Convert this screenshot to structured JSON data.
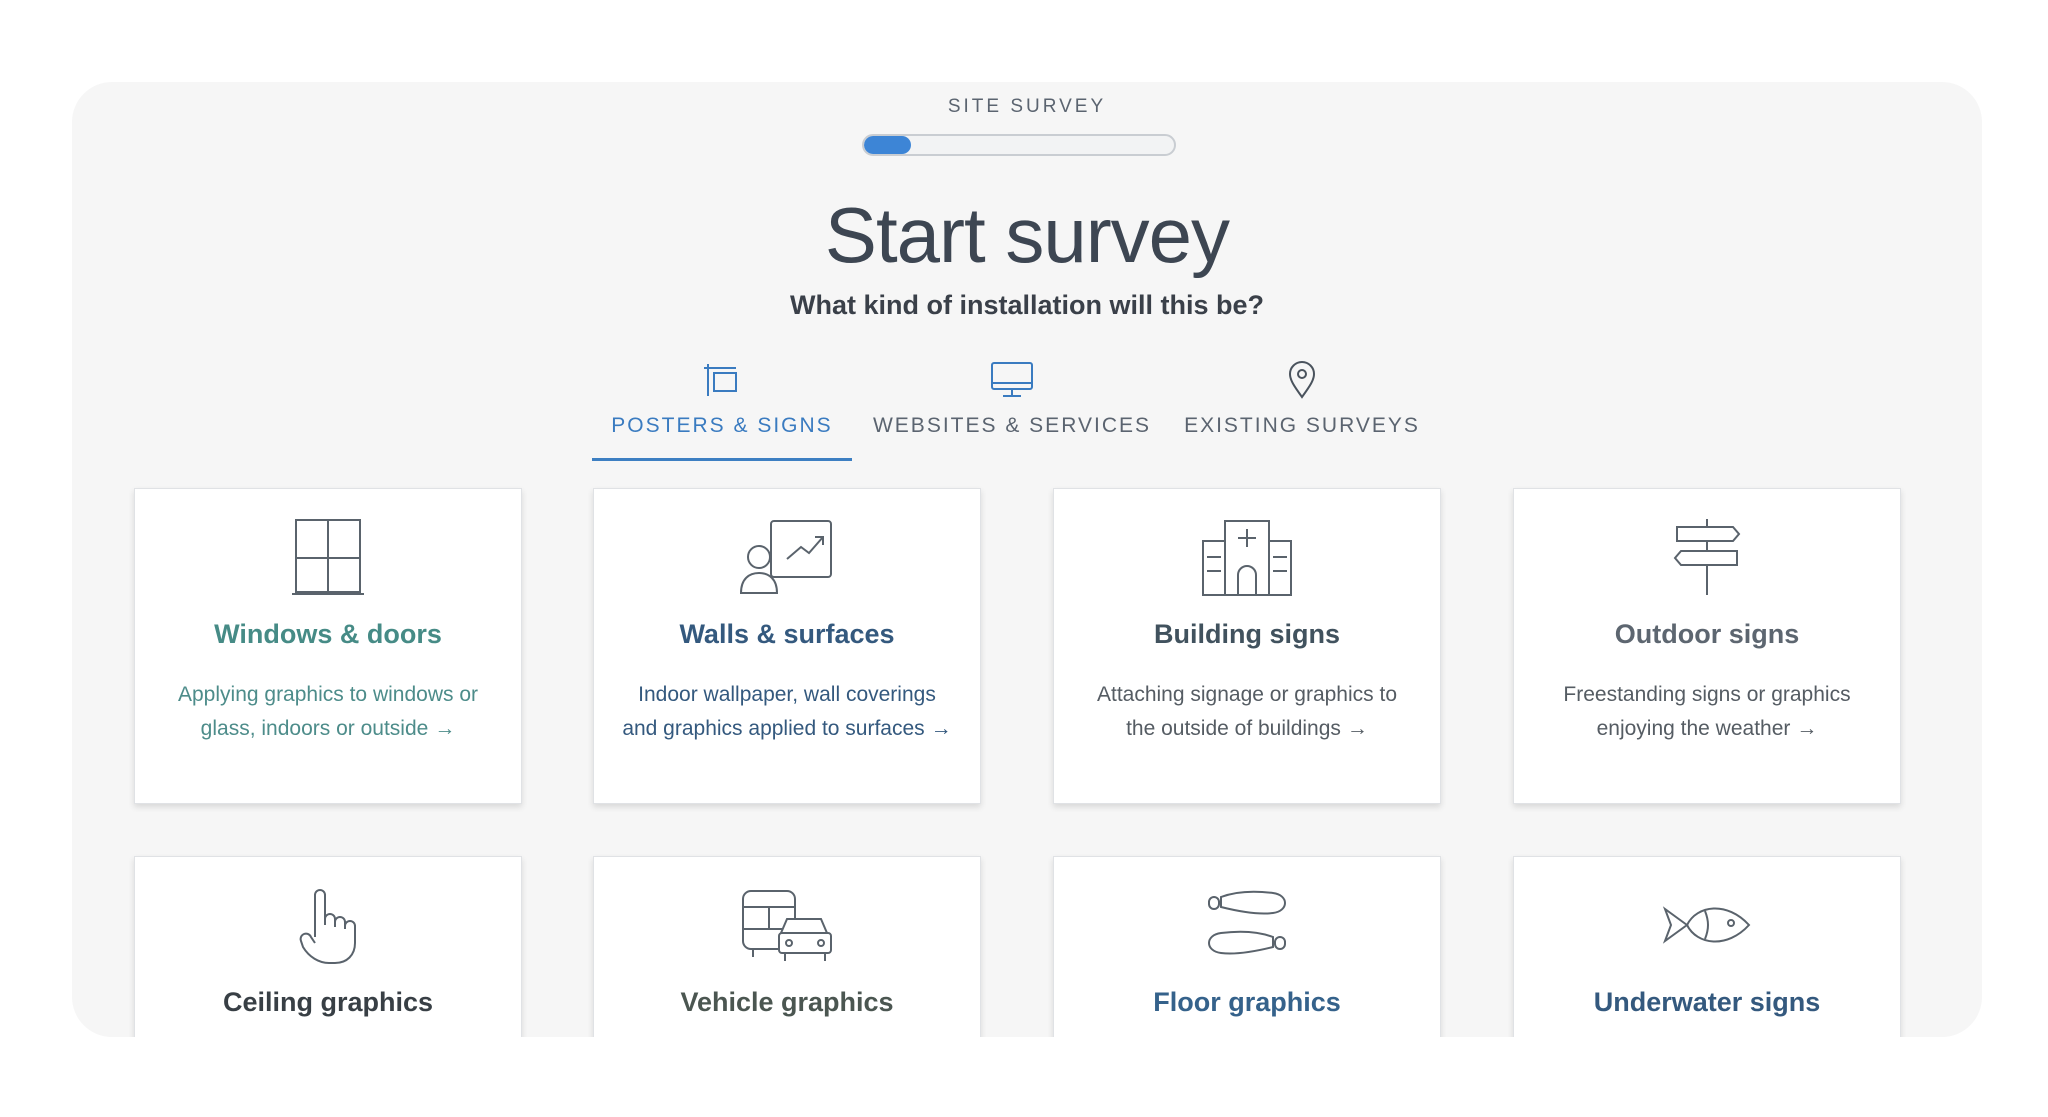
{
  "survey": {
    "label": "SITE SURVEY",
    "progress_percent": 15,
    "title": "Start survey",
    "question": "What kind of installation will this be?"
  },
  "tabs": [
    {
      "label": "POSTERS & SIGNS",
      "icon": "sign-post-icon",
      "active": true
    },
    {
      "label": "WEBSITES & SERVICES",
      "icon": "monitor-icon",
      "active": false
    },
    {
      "label": "EXISTING SURVEYS",
      "icon": "map-pin-icon",
      "active": false
    }
  ],
  "cards": [
    {
      "title": "Windows & doors",
      "desc": "Applying graphics to windows or glass, indoors or outside",
      "icon": "window-icon",
      "color": "#468b86"
    },
    {
      "title": "Walls & surfaces",
      "desc": "Indoor wallpaper, wall coverings and graphics applied to surfaces",
      "icon": "presentation-icon",
      "color": "#34597e"
    },
    {
      "title": "Building signs",
      "desc": "Attaching signage or graphics to the outside of buildings",
      "icon": "hospital-building-icon",
      "color": "#41525e"
    },
    {
      "title": "Outdoor signs",
      "desc": "Freestanding signs or graphics enjoying the weather",
      "icon": "signpost-icon",
      "color": "#5d6670"
    },
    {
      "title": "Ceiling graphics",
      "icon": "pointing-hand-icon",
      "color": "#383f45"
    },
    {
      "title": "Vehicle graphics",
      "icon": "vehicles-icon",
      "color": "#4b5651"
    },
    {
      "title": "Floor graphics",
      "icon": "footprints-icon",
      "color": "#35628b"
    },
    {
      "title": "Underwater signs",
      "icon": "fish-icon",
      "color": "#34597e"
    }
  ],
  "arrow": "→",
  "colors": {
    "accent": "#3d85d6",
    "active_tab": "#3a7bc0",
    "panel_bg": "#f6f6f6"
  }
}
